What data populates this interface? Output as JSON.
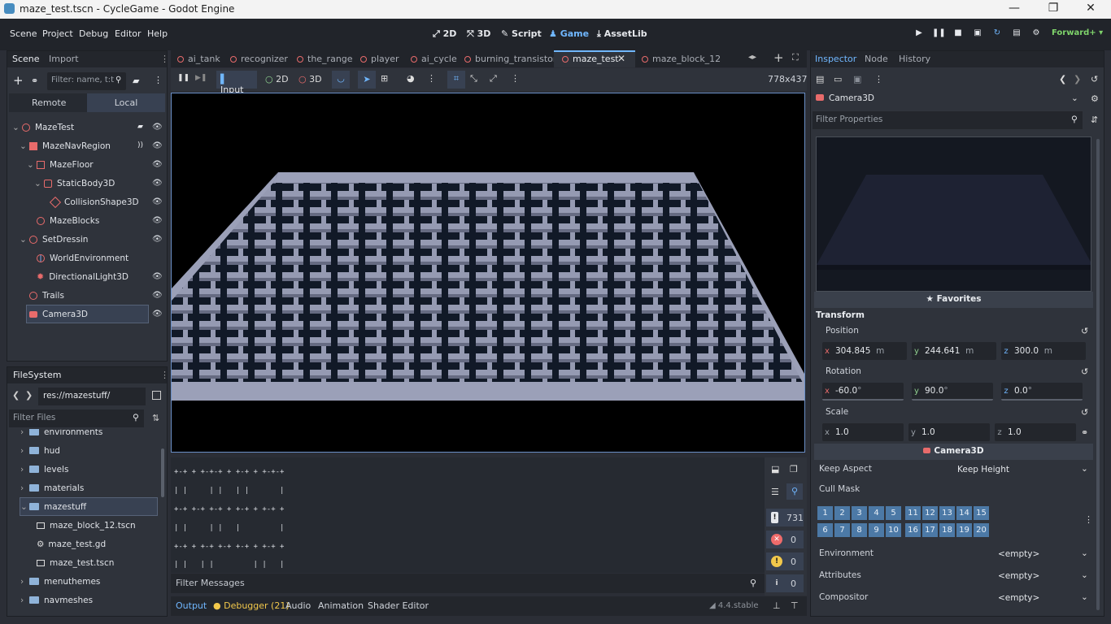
{
  "window": {
    "title": "maze_test.tscn - CycleGame - Godot Engine",
    "controls": [
      "—",
      "❐",
      "✕"
    ]
  },
  "menu": [
    "Scene",
    "Project",
    "Debug",
    "Editor",
    "Help"
  ],
  "workspaces": [
    {
      "label": "2D",
      "icon": "2d-icon"
    },
    {
      "label": "3D",
      "icon": "3d-icon"
    },
    {
      "label": "Script",
      "icon": "script-icon"
    },
    {
      "label": "Game",
      "icon": "game-icon",
      "active": true
    },
    {
      "label": "AssetLib",
      "icon": "assetlib-icon"
    }
  ],
  "renderer": "Forward+",
  "scene_dock": {
    "tabs": [
      "Scene",
      "Import"
    ],
    "filter_placeholder": "Filter: name, t:t",
    "modes": [
      "Remote",
      "Local"
    ],
    "tree": [
      {
        "label": "MazeTest",
        "depth": 0,
        "icon_color": "#e86b6b",
        "expanded": true
      },
      {
        "label": "MazeNavRegion",
        "depth": 1,
        "icon_color": "#e86b6b",
        "expanded": true
      },
      {
        "label": "MazeFloor",
        "depth": 2,
        "icon_color": "#e86b6b",
        "expanded": true
      },
      {
        "label": "StaticBody3D",
        "depth": 3,
        "icon_color": "#e86b6b",
        "expanded": true
      },
      {
        "label": "CollisionShape3D",
        "depth": 4,
        "icon_color": "#e86b6b"
      },
      {
        "label": "MazeBlocks",
        "depth": 2,
        "icon_color": "#e86b6b"
      },
      {
        "label": "SetDressin",
        "depth": 1,
        "icon_color": "#e86b6b",
        "expanded": true
      },
      {
        "label": "WorldEnvironment",
        "depth": 2,
        "icon_color": "#e86b6b"
      },
      {
        "label": "DirectionalLight3D",
        "depth": 2,
        "icon_color": "#e86b6b"
      },
      {
        "label": "Trails",
        "depth": 1,
        "icon_color": "#e86b6b"
      },
      {
        "label": "Camera3D",
        "depth": 1,
        "icon_color": "#e86b6b",
        "selected": true
      }
    ]
  },
  "filesystem": {
    "tab": "FileSystem",
    "path": "res://mazestuff/",
    "filter_placeholder": "Filter Files",
    "items": [
      {
        "label": "environments",
        "type": "folder",
        "depth": 1
      },
      {
        "label": "hud",
        "type": "folder",
        "depth": 1
      },
      {
        "label": "levels",
        "type": "folder",
        "depth": 1
      },
      {
        "label": "materials",
        "type": "folder",
        "depth": 1
      },
      {
        "label": "mazestuff",
        "type": "folder",
        "depth": 1,
        "selected": true
      },
      {
        "label": "maze_block_12.tscn",
        "type": "scene",
        "depth": 2
      },
      {
        "label": "maze_test.gd",
        "type": "script",
        "depth": 2
      },
      {
        "label": "maze_test.tscn",
        "type": "scene",
        "depth": 2
      },
      {
        "label": "menuthemes",
        "type": "folder",
        "depth": 1
      },
      {
        "label": "navmeshes",
        "type": "folder",
        "depth": 1
      }
    ]
  },
  "editor_tabs": [
    "ai_tank",
    "recognizer",
    "the_range",
    "player",
    "ai_cycle",
    "burning_transistor",
    "maze_test",
    "maze_block_12"
  ],
  "active_editor_tab": "maze_test",
  "game_toolbar": {
    "modes": [
      "Input",
      "2D",
      "3D"
    ],
    "resolution": "778x437"
  },
  "output": {
    "lines": [
      "+-+ + +-+-+ + +-+ + +-+-+",
      "| |     | |   | |       |",
      "+-+ +-+ +-+ + +-+ + +-+ +",
      "| |     | |   |         |",
      "+-+ + +-+ +-+ +-+ + +-+ +",
      "| |   | |         | |   |",
      "+-+ +-+ +-+ +-+ +-+-+-+-+",
      "| | |!  | | |   | | | | |",
      "+-+-+-+-+-+-+-+ +-+-+-+-+"
    ],
    "filter_placeholder": "Filter Messages",
    "counts": {
      "log": "731",
      "errors": "0",
      "warnings": "0",
      "info": "0"
    }
  },
  "bottom_tabs": [
    "Output",
    "Debugger (21)",
    "Audio",
    "Animation",
    "Shader Editor"
  ],
  "version": "4.4.stable",
  "inspector": {
    "tabs": [
      "Inspector",
      "Node",
      "History"
    ],
    "object": "Camera3D",
    "filter_placeholder": "Filter Properties",
    "favorites": "Favorites",
    "transform": "Transform",
    "position_label": "Position",
    "position": {
      "x": "304.845",
      "y": "244.641",
      "z": "300.0",
      "unit": "m"
    },
    "rotation_label": "Rotation",
    "rotation": {
      "x": "-60.0",
      "y": "90.0",
      "z": "0.0",
      "unit": "°"
    },
    "scale_label": "Scale",
    "scale": {
      "x": "1.0",
      "y": "1.0",
      "z": "1.0"
    },
    "camera_section": "Camera3D",
    "keep_aspect_label": "Keep Aspect",
    "keep_aspect_value": "Keep Height",
    "cull_mask_label": "Cull Mask",
    "cull_mask_top": [
      "1",
      "2",
      "3",
      "4",
      "5",
      "11",
      "12",
      "13",
      "14",
      "15"
    ],
    "cull_mask_bottom": [
      "6",
      "7",
      "8",
      "9",
      "10",
      "16",
      "17",
      "18",
      "19",
      "20"
    ],
    "environment_label": "Environment",
    "attributes_label": "Attributes",
    "compositor_label": "Compositor",
    "empty": "<empty>"
  },
  "colors": {
    "accent": "#70b7ff",
    "node_red": "#e86b6b",
    "folder": "#8fb3d9",
    "maze_wall": "#9ba0b8",
    "layer_btn": "#4c79a6"
  }
}
